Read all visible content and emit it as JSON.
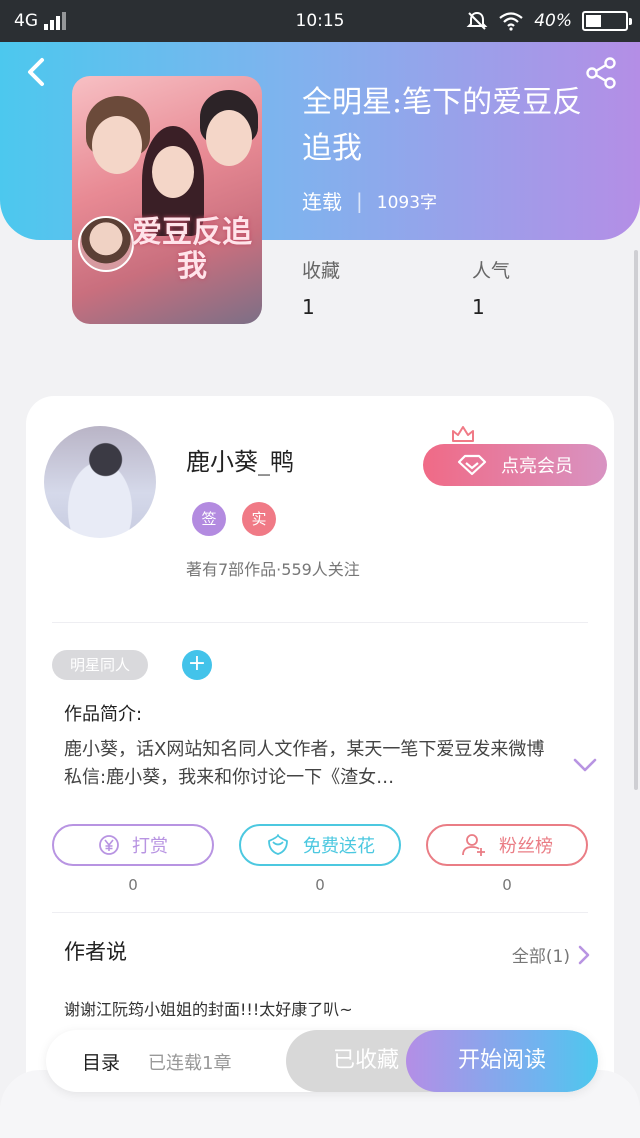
{
  "status_bar": {
    "network": "4G",
    "time": "10:15",
    "battery": "40%",
    "icons": [
      "signal-icon",
      "mute-icon",
      "wifi-icon",
      "battery-icon"
    ]
  },
  "header": {
    "back_icon": "back-arrow-icon",
    "share_icon": "share-icon",
    "cover_title": "爱豆反追我",
    "title": "全明星:笔下的爱豆反追我",
    "status": "连载",
    "word_count": "1093字",
    "stats": [
      {
        "label": "收藏",
        "value": "1"
      },
      {
        "label": "人气",
        "value": "1"
      }
    ],
    "gradient_colors": [
      "#4cc8ee",
      "#b48ee6"
    ]
  },
  "author": {
    "name": "鹿小葵_鸭",
    "badges": [
      {
        "text": "签",
        "color": "#b38be0"
      },
      {
        "text": "实",
        "color": "#f07a86"
      }
    ],
    "works_info": "著有7部作品·559人关注",
    "vip_button": "点亮会员"
  },
  "tags": {
    "items": [
      "明星同人"
    ],
    "add_label": "+"
  },
  "intro": {
    "title": "作品简介:",
    "text": "鹿小葵，话X网站知名同人文作者，某天一笔下爱豆发来微博私信:鹿小葵，我来和你讨论一下《渣女…"
  },
  "actions": [
    {
      "label": "打赏",
      "count": "0",
      "icon": "yen-icon",
      "color": "#b894e2"
    },
    {
      "label": "免费送花",
      "count": "0",
      "icon": "flower-icon",
      "color": "#4cc8e0"
    },
    {
      "label": "粉丝榜",
      "count": "0",
      "icon": "fans-icon",
      "color": "#ea7d85"
    }
  ],
  "author_says": {
    "title": "作者说",
    "all_label": "全部(1)",
    "text": "谢谢江阮筠小姐姐的封面!!!太好康了叭~"
  },
  "bottom_bar": {
    "toc_label": "目录",
    "toc_status": "已连载1章",
    "collected_label": "已收藏",
    "start_label": "开始阅读"
  }
}
